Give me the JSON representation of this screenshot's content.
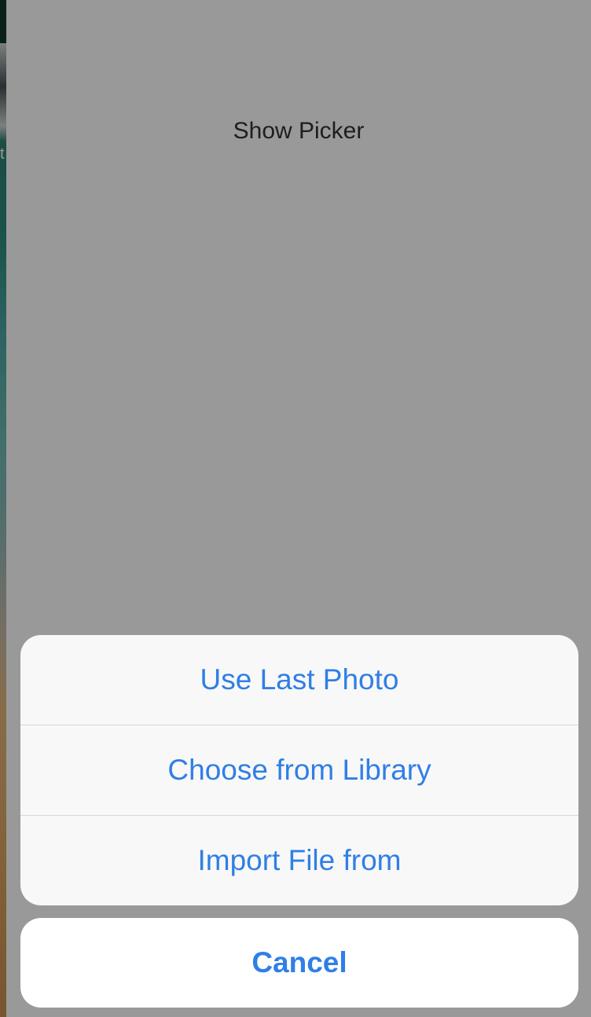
{
  "background": {
    "edge_fragment": "t"
  },
  "app": {
    "show_picker_label": "Show Picker"
  },
  "action_sheet": {
    "options": [
      {
        "label": "Use Last Photo"
      },
      {
        "label": "Choose from Library"
      },
      {
        "label": "Import File from"
      }
    ],
    "cancel_label": "Cancel"
  },
  "colors": {
    "accent": "#2f7fe6",
    "sheet_background": "#f8f8f8",
    "cancel_background": "#ffffff",
    "overlay": "rgba(0,0,0,0.40)"
  }
}
